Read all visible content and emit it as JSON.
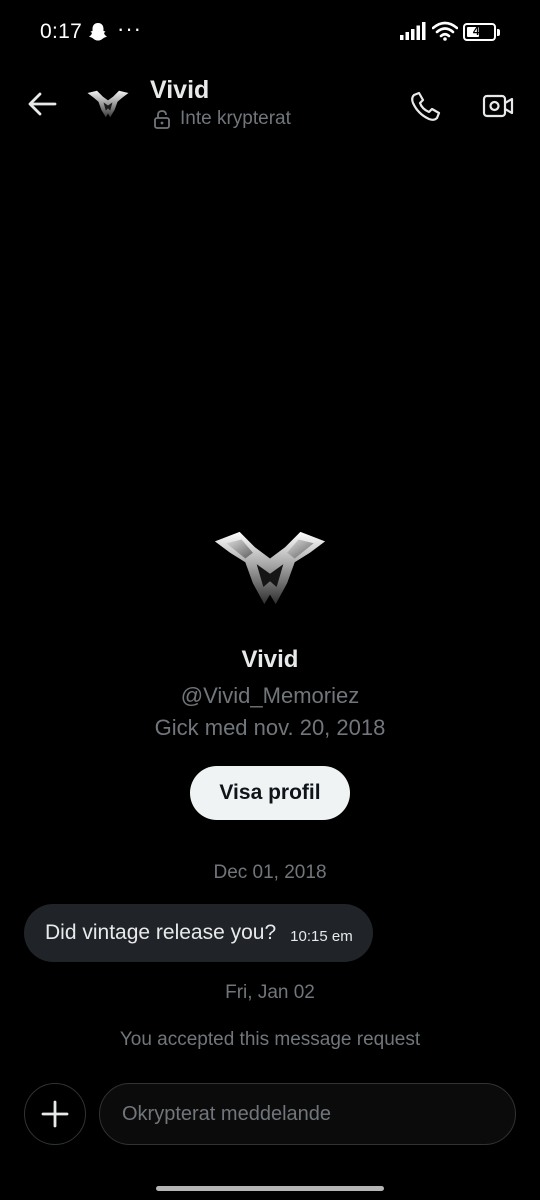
{
  "status_bar": {
    "time": "0:17",
    "battery_level": "47",
    "battery_fraction": 0.47
  },
  "header": {
    "title": "Vivid",
    "subtitle": "Inte krypterat",
    "icons": [
      "arrow-left-icon",
      "avatar-logo",
      "lock-open-icon",
      "phone-icon",
      "video-camera-icon"
    ]
  },
  "profile": {
    "name": "Vivid",
    "handle": "@Vivid_Memoriez",
    "joined": "Gick med nov. 20, 2018",
    "view_button_label": "Visa profil"
  },
  "conversation": {
    "date_1": "Dec 01, 2018",
    "messages": [
      {
        "text": "Did vintage release you?",
        "time": "10:15 em"
      }
    ],
    "date_2": "Fri, Jan 02",
    "system_note": "You accepted this message request"
  },
  "composer": {
    "placeholder": "Okrypterat meddelande"
  },
  "colors": {
    "background": "#000000",
    "primary_text": "#e7e9ea",
    "secondary_text": "#71767b",
    "bubble": "#202327",
    "button_bg": "#eff3f4",
    "border": "#2f3336"
  }
}
